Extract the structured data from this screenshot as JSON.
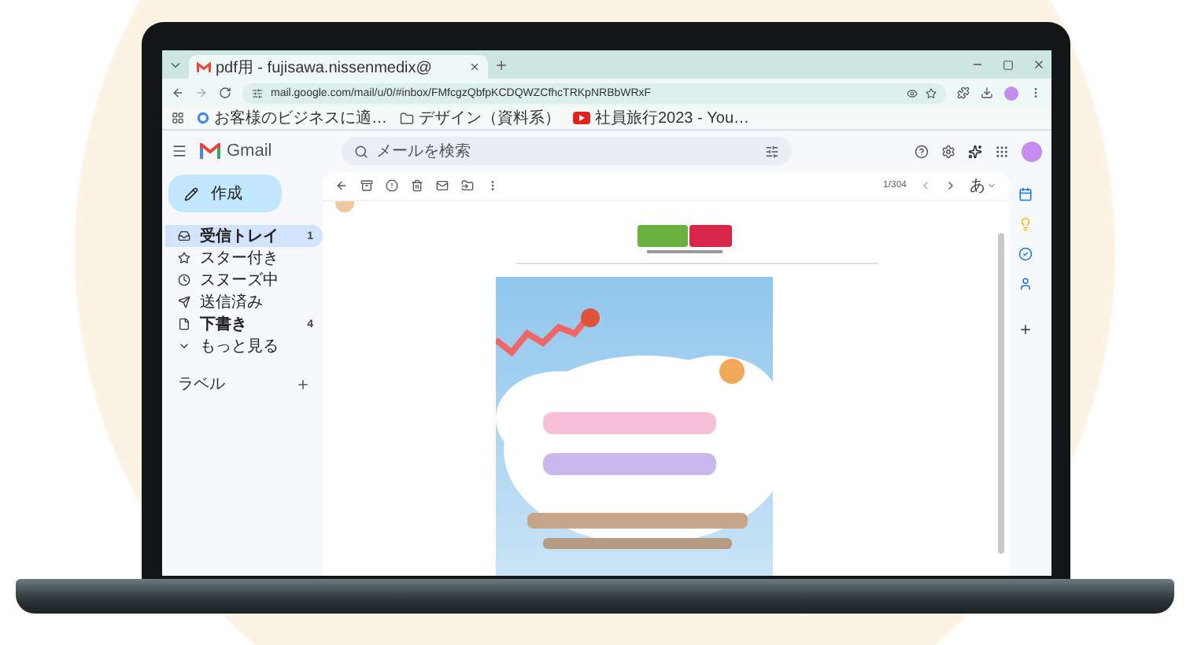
{
  "browser": {
    "tabs": [
      {
        "title": "pdf用 - fujisawa.nissenmedix@",
        "selected": true
      }
    ],
    "url": "mail.google.com/mail/u/0/#inbox/FMfcgzQbfpKCDQWZCfhcTRKpNRBbWRxF",
    "bookmarks": [
      {
        "label": "お客様のビジネスに適…",
        "kind": "google"
      },
      {
        "label": "デザイン（資料系）",
        "kind": "folder"
      },
      {
        "label": "社員旅行2023 - You…",
        "kind": "video"
      }
    ]
  },
  "gmail": {
    "app_name": "Gmail",
    "search": {
      "placeholder": "メールを検索"
    },
    "compose": "作成",
    "nav": [
      {
        "label": "受信トレイ",
        "count": "1",
        "selected": true,
        "unread": true,
        "kind": "inbox"
      },
      {
        "label": "スター付き",
        "selected": false,
        "unread": false,
        "kind": "star"
      },
      {
        "label": "スヌーズ中",
        "selected": false,
        "unread": false,
        "kind": "snooze"
      },
      {
        "label": "送信済み",
        "selected": false,
        "unread": false,
        "kind": "sent"
      },
      {
        "label": "下書き",
        "count": "4",
        "selected": false,
        "unread": true,
        "kind": "draft"
      },
      {
        "label": "もっと見る",
        "selected": false,
        "unread": false,
        "kind": "more"
      }
    ],
    "labels_heading": "ラベル",
    "message": {
      "counter": "1/304",
      "input_tool": "あ"
    }
  }
}
